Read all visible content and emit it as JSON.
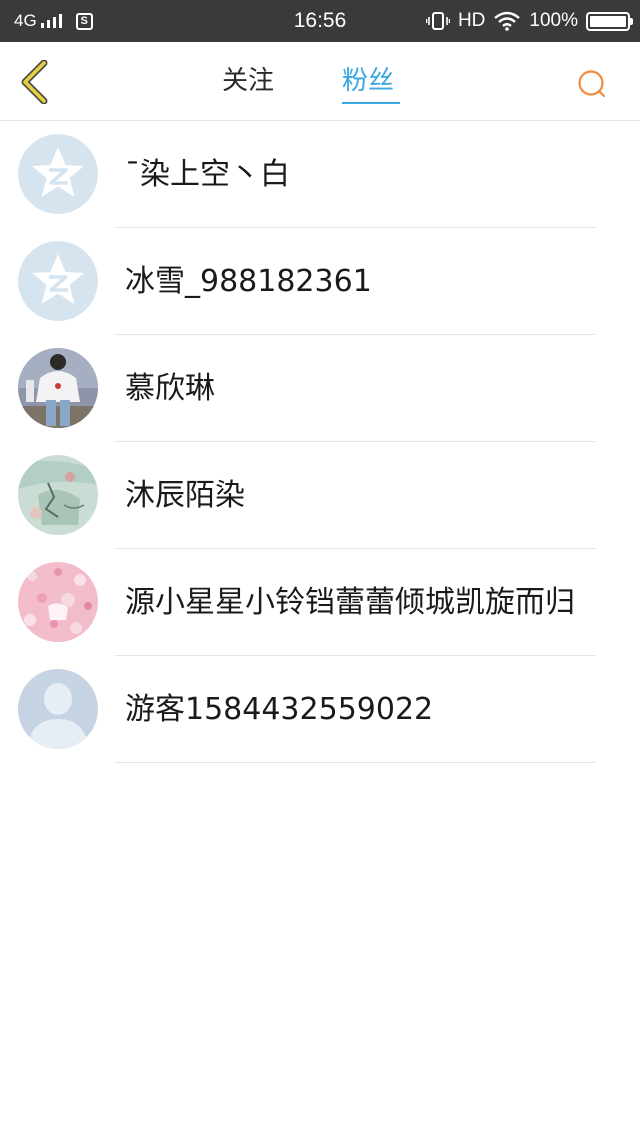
{
  "status_bar": {
    "network": "4G",
    "sim_icon": "S",
    "time": "16:56",
    "hd": "HD",
    "battery": "100%",
    "icons": [
      "signal-icon",
      "sim-icon",
      "vibrate-icon",
      "wifi-icon",
      "battery-icon"
    ]
  },
  "header": {
    "back_icon": "chevron-left-icon",
    "tabs": [
      {
        "label": "关注",
        "active": false
      },
      {
        "label": "粉丝",
        "active": true
      }
    ],
    "search_icon": "search-icon",
    "accent_color": "#3aa7e0",
    "back_color": "#e8d040",
    "search_color": "#f08a3c"
  },
  "fans": [
    {
      "name": "ˉ染上空丶白",
      "avatar": "qzone-default"
    },
    {
      "name": "冰雪_988182361",
      "avatar": "qzone-default"
    },
    {
      "name": "慕欣琳",
      "avatar": "photo-person"
    },
    {
      "name": "沐辰陌染",
      "avatar": "photo-mint"
    },
    {
      "name": "源小星星小铃铛蕾蕾倾城凯旋而归",
      "avatar": "photo-pink-floral"
    },
    {
      "name": "游客1584432559022",
      "avatar": "default-person"
    }
  ]
}
